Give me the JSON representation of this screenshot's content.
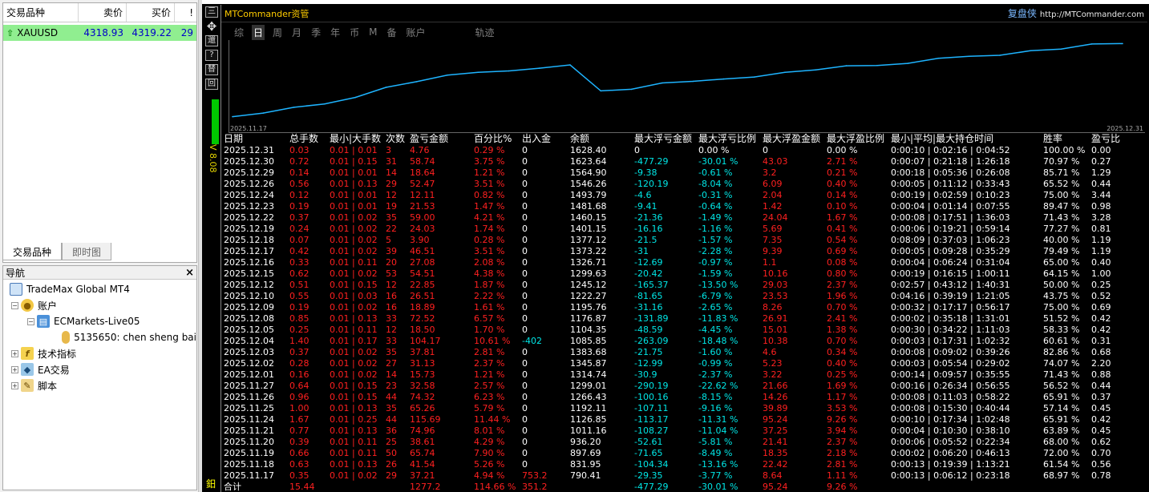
{
  "colors": {
    "positive": "#ff2020",
    "negative": "#00e6e6",
    "equity_curve": "#1eb4ff",
    "header_title": "#ffcc00",
    "symbol_row_bg": "#90ee90"
  },
  "market_watch": {
    "headers": {
      "symbol": "交易品种",
      "bid": "卖价",
      "ask": "买价",
      "excl": "!"
    },
    "rows": [
      {
        "symbol": "XAUUSD",
        "bid": "4318.93",
        "ask": "4319.22",
        "spread": "29"
      }
    ],
    "tabs": [
      "交易品种",
      "即时图"
    ]
  },
  "navigator": {
    "title": "导航",
    "close": "×",
    "items": [
      {
        "label": "TradeMax Global MT4"
      },
      {
        "label": "账户"
      },
      {
        "label": "ECMarkets-Live05"
      },
      {
        "label": "5135650: chen sheng bai"
      },
      {
        "label": "技术指标"
      },
      {
        "label": "EA交易"
      },
      {
        "label": "脚本"
      }
    ]
  },
  "side_toolbar": {
    "items": [
      "三",
      "✥",
      "還",
      "?",
      "替",
      "回"
    ],
    "vertical_label": "V 8.08",
    "bottom_tag": "鈤"
  },
  "panel": {
    "title": "MTCommander资管",
    "brand": "复盘侠",
    "url": "http://MTCommander.com",
    "tabs": [
      "综",
      "日",
      "周",
      "月",
      "季",
      "年",
      "币",
      "M",
      "备",
      "账户",
      "轨迹"
    ],
    "active_tab": "日"
  },
  "chart_data": {
    "type": "line",
    "x_start_label": "2025.11.17",
    "x_end_label": "2025.12.31",
    "series": [
      {
        "x": [
          "2025.11.17",
          "2025.11.18",
          "2025.11.19",
          "2025.11.20",
          "2025.11.21",
          "2025.11.24",
          "2025.11.25",
          "2025.11.26",
          "2025.11.27",
          "2025.12.01",
          "2025.12.02",
          "2025.12.03",
          "2025.12.04",
          "2025.12.05",
          "2025.12.08",
          "2025.12.09",
          "2025.12.10",
          "2025.12.12",
          "2025.12.15",
          "2025.12.16",
          "2025.12.17",
          "2025.12.18",
          "2025.12.19",
          "2025.12.22",
          "2025.12.23",
          "2025.12.24",
          "2025.12.26",
          "2025.12.29",
          "2025.12.30",
          "2025.12.31"
        ],
        "values": [
          790.41,
          831.95,
          897.69,
          936.2,
          1011.16,
          1126.85,
          1192.11,
          1266.43,
          1299.01,
          1314.74,
          1345.87,
          1383.68,
          1085.85,
          1104.35,
          1176.87,
          1195.76,
          1222.27,
          1245.12,
          1299.63,
          1326.71,
          1373.22,
          1377.12,
          1401.15,
          1460.15,
          1481.68,
          1493.79,
          1546.26,
          1564.9,
          1623.64,
          1628.4
        ]
      }
    ],
    "ylim": [
      750,
      1650
    ],
    "grid": false
  },
  "table": {
    "headers": [
      "日期",
      "总手数",
      "最小|大手数",
      "次数",
      "盈亏金额",
      "百分比%",
      "出入金",
      "余额",
      "最大浮亏金额",
      "最大浮亏比例",
      "最大浮盈金额",
      "最大浮盈比例",
      "最小|平均|最大持仓时间",
      "胜率",
      "盈亏比"
    ],
    "rows": [
      [
        "2025.12.31",
        "0.03",
        "0.01 | 0.01",
        "3",
        "4.76",
        "0.29 %",
        "0",
        "1628.40",
        "0",
        "0.00 %",
        "0",
        "0.00 %",
        "0:00:10 | 0:02:16 | 0:04:52",
        "100.00 %",
        "0.00"
      ],
      [
        "2025.12.30",
        "0.72",
        "0.01 | 0.15",
        "31",
        "58.74",
        "3.75 %",
        "0",
        "1623.64",
        "-477.29",
        "-30.01 %",
        "43.03",
        "2.71 %",
        "0:00:07 | 0:21:18 | 1:26:18",
        "70.97 %",
        "0.27"
      ],
      [
        "2025.12.29",
        "0.14",
        "0.01 | 0.01",
        "14",
        "18.64",
        "1.21 %",
        "0",
        "1564.90",
        "-9.38",
        "-0.61 %",
        "3.2",
        "0.21 %",
        "0:00:18 | 0:05:36 | 0:26:08",
        "85.71 %",
        "1.29"
      ],
      [
        "2025.12.26",
        "0.56",
        "0.01 | 0.13",
        "29",
        "52.47",
        "3.51 %",
        "0",
        "1546.26",
        "-120.19",
        "-8.04 %",
        "6.09",
        "0.40 %",
        "0:00:05 | 0:11:12 | 0:33:43",
        "65.52 %",
        "0.44"
      ],
      [
        "2025.12.24",
        "0.12",
        "0.01 | 0.01",
        "12",
        "12.11",
        "0.82 %",
        "0",
        "1493.79",
        "-4.6",
        "-0.31 %",
        "2.04",
        "0.14 %",
        "0:00:19 | 0:02:59 | 0:10:23",
        "75.00 %",
        "3.44"
      ],
      [
        "2025.12.23",
        "0.19",
        "0.01 | 0.01",
        "19",
        "21.53",
        "1.47 %",
        "0",
        "1481.68",
        "-9.41",
        "-0.64 %",
        "1.42",
        "0.10 %",
        "0:00:04 | 0:01:14 | 0:07:55",
        "89.47 %",
        "0.98"
      ],
      [
        "2025.12.22",
        "0.37",
        "0.01 | 0.02",
        "35",
        "59.00",
        "4.21 %",
        "0",
        "1460.15",
        "-21.36",
        "-1.49 %",
        "24.04",
        "1.67 %",
        "0:00:08 | 0:17:51 | 1:36:03",
        "71.43 %",
        "3.28"
      ],
      [
        "2025.12.19",
        "0.24",
        "0.01 | 0.02",
        "22",
        "24.03",
        "1.74 %",
        "0",
        "1401.15",
        "-16.16",
        "-1.16 %",
        "5.69",
        "0.41 %",
        "0:00:06 | 0:19:21 | 0:59:14",
        "77.27 %",
        "0.81"
      ],
      [
        "2025.12.18",
        "0.07",
        "0.01 | 0.02",
        "5",
        "3.90",
        "0.28 %",
        "0",
        "1377.12",
        "-21.5",
        "-1.57 %",
        "7.35",
        "0.54 %",
        "0:08:09 | 0:37:03 | 1:06:23",
        "40.00 %",
        "1.19"
      ],
      [
        "2025.12.17",
        "0.42",
        "0.01 | 0.02",
        "39",
        "46.51",
        "3.51 %",
        "0",
        "1373.22",
        "-31",
        "-2.28 %",
        "9.39",
        "0.69 %",
        "0:00:05 | 0:09:28 | 0:35:29",
        "79.49 %",
        "1.19"
      ],
      [
        "2025.12.16",
        "0.33",
        "0.01 | 0.11",
        "20",
        "27.08",
        "2.08 %",
        "0",
        "1326.71",
        "-12.69",
        "-0.97 %",
        "1.1",
        "0.08 %",
        "0:00:04 | 0:06:24 | 0:31:04",
        "65.00 %",
        "0.40"
      ],
      [
        "2025.12.15",
        "0.62",
        "0.01 | 0.02",
        "53",
        "54.51",
        "4.38 %",
        "0",
        "1299.63",
        "-20.42",
        "-1.59 %",
        "10.16",
        "0.80 %",
        "0:00:19 | 0:16:15 | 1:00:11",
        "64.15 %",
        "1.00"
      ],
      [
        "2025.12.12",
        "0.51",
        "0.01 | 0.15",
        "12",
        "22.85",
        "1.87 %",
        "0",
        "1245.12",
        "-165.37",
        "-13.50 %",
        "29.03",
        "2.37 %",
        "0:02:57 | 0:43:12 | 1:40:31",
        "50.00 %",
        "0.25"
      ],
      [
        "2025.12.10",
        "0.55",
        "0.01 | 0.03",
        "16",
        "26.51",
        "2.22 %",
        "0",
        "1222.27",
        "-81.65",
        "-6.79 %",
        "23.53",
        "1.96 %",
        "0:04:16 | 0:39:19 | 1:21:05",
        "43.75 %",
        "0.52"
      ],
      [
        "2025.12.09",
        "0.19",
        "0.01 | 0.02",
        "16",
        "18.89",
        "1.61 %",
        "0",
        "1195.76",
        "-31.16",
        "-2.65 %",
        "8.26",
        "0.70 %",
        "0:00:32 | 0:17:17 | 0:56:17",
        "75.00 %",
        "0.69"
      ],
      [
        "2025.12.08",
        "0.85",
        "0.01 | 0.13",
        "33",
        "72.52",
        "6.57 %",
        "0",
        "1176.87",
        "-131.89",
        "-11.83 %",
        "26.91",
        "2.41 %",
        "0:00:02 | 0:35:18 | 1:31:01",
        "51.52 %",
        "0.42"
      ],
      [
        "2025.12.05",
        "0.25",
        "0.01 | 0.11",
        "12",
        "18.50",
        "1.70 %",
        "0",
        "1104.35",
        "-48.59",
        "-4.45 %",
        "15.01",
        "1.38 %",
        "0:00:30 | 0:34:22 | 1:11:03",
        "58.33 %",
        "0.42"
      ],
      [
        "2025.12.04",
        "1.40",
        "0.01 | 0.17",
        "33",
        "104.17",
        "10.61 %",
        "-402",
        "1085.85",
        "-263.09",
        "-18.48 %",
        "10.38",
        "0.70 %",
        "0:00:03 | 0:17:31 | 1:02:32",
        "60.61 %",
        "0.31"
      ],
      [
        "2025.12.03",
        "0.37",
        "0.01 | 0.02",
        "35",
        "37.81",
        "2.81 %",
        "0",
        "1383.68",
        "-21.75",
        "-1.60 %",
        "4.6",
        "0.34 %",
        "0:00:08 | 0:09:02 | 0:39:26",
        "82.86 %",
        "0.68"
      ],
      [
        "2025.12.02",
        "0.28",
        "0.01 | 0.02",
        "27",
        "31.13",
        "2.37 %",
        "0",
        "1345.87",
        "-12.99",
        "-0.99 %",
        "5.23",
        "0.40 %",
        "0:00:03 | 0:05:54 | 0:29:02",
        "74.07 %",
        "2.20"
      ],
      [
        "2025.12.01",
        "0.16",
        "0.01 | 0.02",
        "14",
        "15.73",
        "1.21 %",
        "0",
        "1314.74",
        "-30.9",
        "-2.37 %",
        "3.22",
        "0.25 %",
        "0:00:14 | 0:09:57 | 0:35:55",
        "71.43 %",
        "0.88"
      ],
      [
        "2025.11.27",
        "0.64",
        "0.01 | 0.15",
        "23",
        "32.58",
        "2.57 %",
        "0",
        "1299.01",
        "-290.19",
        "-22.62 %",
        "21.66",
        "1.69 %",
        "0:00:16 | 0:26:34 | 0:56:55",
        "56.52 %",
        "0.44"
      ],
      [
        "2025.11.26",
        "0.96",
        "0.01 | 0.15",
        "44",
        "74.32",
        "6.23 %",
        "0",
        "1266.43",
        "-100.16",
        "-8.15 %",
        "14.26",
        "1.17 %",
        "0:00:08 | 0:11:03 | 0:58:22",
        "65.91 %",
        "0.37"
      ],
      [
        "2025.11.25",
        "1.00",
        "0.01 | 0.13",
        "35",
        "65.26",
        "5.79 %",
        "0",
        "1192.11",
        "-107.11",
        "-9.16 %",
        "39.89",
        "3.53 %",
        "0:00:08 | 0:15:30 | 0:40:44",
        "57.14 %",
        "0.45"
      ],
      [
        "2025.11.24",
        "1.67",
        "0.01 | 0.25",
        "44",
        "115.69",
        "11.44 %",
        "0",
        "1126.85",
        "-113.17",
        "-11.31 %",
        "95.24",
        "9.26 %",
        "0:00:10 | 0:17:34 | 1:02:48",
        "65.91 %",
        "0.42"
      ],
      [
        "2025.11.21",
        "0.77",
        "0.01 | 0.13",
        "36",
        "74.96",
        "8.01 %",
        "0",
        "1011.16",
        "-108.27",
        "-11.04 %",
        "37.25",
        "3.94 %",
        "0:00:04 | 0:10:30 | 0:38:10",
        "63.89 %",
        "0.45"
      ],
      [
        "2025.11.20",
        "0.39",
        "0.01 | 0.11",
        "25",
        "38.61",
        "4.29 %",
        "0",
        "936.20",
        "-52.61",
        "-5.81 %",
        "21.41",
        "2.37 %",
        "0:00:06 | 0:05:52 | 0:22:34",
        "68.00 %",
        "0.62"
      ],
      [
        "2025.11.19",
        "0.66",
        "0.01 | 0.11",
        "50",
        "65.74",
        "7.90 %",
        "0",
        "897.69",
        "-71.65",
        "-8.49 %",
        "18.35",
        "2.18 %",
        "0:00:02 | 0:06:20 | 0:46:13",
        "72.00 %",
        "0.70"
      ],
      [
        "2025.11.18",
        "0.63",
        "0.01 | 0.13",
        "26",
        "41.54",
        "5.26 %",
        "0",
        "831.95",
        "-104.34",
        "-13.16 %",
        "22.42",
        "2.81 %",
        "0:00:13 | 0:19:39 | 1:13:21",
        "61.54 %",
        "0.56"
      ],
      [
        "2025.11.17",
        "0.35",
        "0.01 | 0.02",
        "29",
        "37.21",
        "4.94 %",
        "753.2",
        "790.41",
        "-29.35",
        "-3.77 %",
        "8.64",
        "1.11 %",
        "0:00:13 | 0:06:12 | 0:23:18",
        "68.97 %",
        "0.78"
      ]
    ],
    "total": [
      "合计",
      "15.44",
      "",
      "",
      "1277.2",
      "114.66 %",
      "351.2",
      "",
      "-477.29",
      "-30.01 %",
      "95.24",
      "9.26 %",
      "",
      "",
      ""
    ]
  }
}
